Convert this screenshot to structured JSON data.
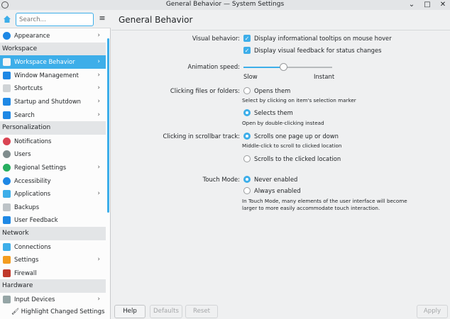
{
  "window": {
    "title": "General Behavior — System Settings",
    "minimize": "⌄",
    "maximize": "□",
    "close": "✕"
  },
  "sidebar": {
    "search": {
      "value": "",
      "placeholder": "Search..."
    },
    "items": [
      {
        "label": "Appearance",
        "chevron": "›",
        "icon_color": "#1e88e5"
      },
      {
        "section": "Workspace"
      },
      {
        "label": "Workspace Behavior",
        "chevron": "›",
        "selected": true,
        "icon_color": "#f5f5f5"
      },
      {
        "label": "Window Management",
        "chevron": "›",
        "icon_color": "#1e88e5"
      },
      {
        "label": "Shortcuts",
        "chevron": "›",
        "icon_color": "#cfd3d6"
      },
      {
        "label": "Startup and Shutdown",
        "chevron": "›",
        "icon_color": "#1e88e5"
      },
      {
        "label": "Search",
        "chevron": "›",
        "icon_color": "#1e88e5"
      },
      {
        "section": "Personalization"
      },
      {
        "label": "Notifications",
        "icon_color": "#da4453"
      },
      {
        "label": "Users",
        "icon_color": "#7f8c8d"
      },
      {
        "label": "Regional Settings",
        "chevron": "›",
        "icon_color": "#27ae60"
      },
      {
        "label": "Accessibility",
        "icon_color": "#1e88e5"
      },
      {
        "label": "Applications",
        "chevron": "›",
        "icon_color": "#3daee9"
      },
      {
        "label": "Backups",
        "icon_color": "#bdc3c7"
      },
      {
        "label": "User Feedback",
        "icon_color": "#1e88e5"
      },
      {
        "section": "Network"
      },
      {
        "label": "Connections",
        "icon_color": "#3daee9"
      },
      {
        "label": "Settings",
        "chevron": "›",
        "icon_color": "#f39c1f"
      },
      {
        "label": "Firewall",
        "icon_color": "#c0392b"
      },
      {
        "section": "Hardware"
      },
      {
        "label": "Input Devices",
        "chevron": "›",
        "icon_color": "#95a5a6"
      }
    ],
    "highlight_button": "Highlight Changed Settings"
  },
  "main": {
    "title": "General Behavior",
    "visual_behavior": {
      "label": "Visual behavior:",
      "options": [
        {
          "text": "Display informational tooltips on mouse hover",
          "checked": true
        },
        {
          "text": "Display visual feedback for status changes",
          "checked": true
        }
      ]
    },
    "animation_speed": {
      "label": "Animation speed:",
      "min_label": "Slow",
      "max_label": "Instant",
      "value": 0.45
    },
    "clicking_files": {
      "label": "Clicking files or folders:",
      "options": [
        {
          "text": "Opens them",
          "selected": false,
          "hint": "Select by clicking on item's selection marker"
        },
        {
          "text": "Selects them",
          "selected": true,
          "hint": "Open by double-clicking instead"
        }
      ]
    },
    "scrollbar": {
      "label": "Clicking in scrollbar track:",
      "options": [
        {
          "text": "Scrolls one page up or down",
          "selected": true,
          "hint": "Middle-click to scroll to clicked location"
        },
        {
          "text": "Scrolls to the clicked location",
          "selected": false
        }
      ]
    },
    "touch_mode": {
      "label": "Touch Mode:",
      "options": [
        {
          "text": "Never enabled",
          "selected": true
        },
        {
          "text": "Always enabled",
          "selected": false
        }
      ],
      "note_line1": "In Touch Mode, many elements of the user interface will become",
      "note_line2": "larger to more easily accommodate touch interaction."
    }
  },
  "footer": {
    "help": "Help",
    "defaults": "Defaults",
    "reset": "Reset",
    "apply": "Apply"
  },
  "colors": {
    "accent": "#3daee9",
    "window_bg": "#eff0f1",
    "sidebar_bg": "#fcfcfc"
  }
}
